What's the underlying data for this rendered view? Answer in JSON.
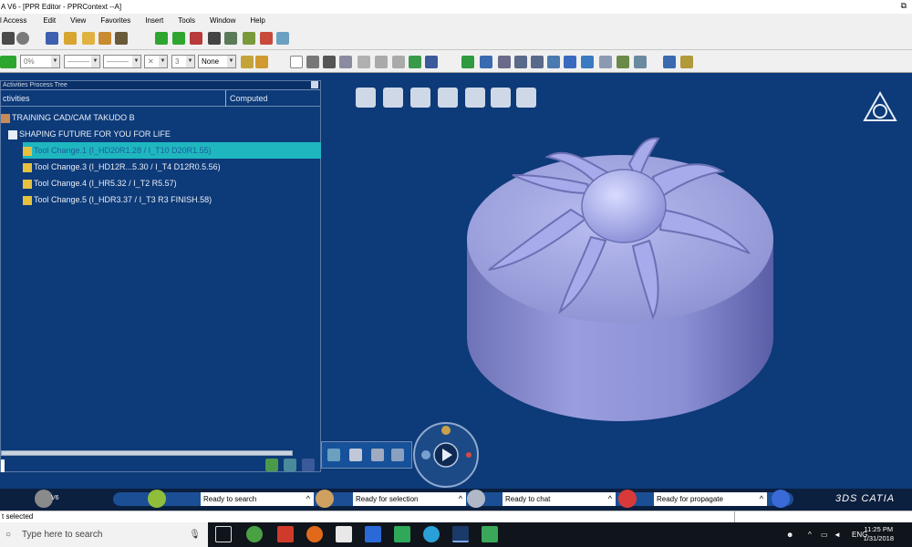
{
  "window": {
    "title": "A V6 - [PPR Editor - PPRContext --A]",
    "restore_symbol": "⧉"
  },
  "menu": {
    "items": [
      "l Access",
      "Edit",
      "View",
      "Favorites",
      "Insert",
      "Tools",
      "Window",
      "Help"
    ]
  },
  "toolbar": {
    "percent_value": "0%",
    "line_value": "———",
    "line_value2": "———",
    "x_value": "✕",
    "layer_value": "3",
    "none_value": "None"
  },
  "tree": {
    "panel_title": "Activities Process Tree",
    "col_activities": "ctivities",
    "col_computed": "Computed",
    "root": "TRAINING CAD/CAM TAKUDO B",
    "process": "SHAPING FUTURE FOR YOU FOR LIFE",
    "items": [
      {
        "label": "Tool Change.1 (I_HD20R1.28 / I_T10 D20R1.55)",
        "selected": true
      },
      {
        "label": "Tool Change.3 (I_HD12R...5.30 / I_T4 D12R0.5.56)",
        "selected": false
      },
      {
        "label": "Tool Change.4 (I_HR5.32 / I_T2 R5.57)",
        "selected": false
      },
      {
        "label": "Tool Change.5 (I_HDR3.37 / I_T3 R3 FINISH.58)",
        "selected": false
      }
    ]
  },
  "statusbar": {
    "v6_label": "V6",
    "search": "Ready to search",
    "selection": "Ready for selection",
    "chat": "Ready to chat",
    "propagate": "Ready for propagate",
    "brand": "CATIA"
  },
  "infobar": {
    "text": "t selected"
  },
  "taskbar": {
    "search_placeholder": "Type here to search",
    "lang": "ENG",
    "time": "11:25 PM",
    "date": "1/31/2018"
  },
  "colors": {
    "viewport_bg": "#0d3a78",
    "selection": "#1fb7bf",
    "part": "#9a9ce0"
  }
}
